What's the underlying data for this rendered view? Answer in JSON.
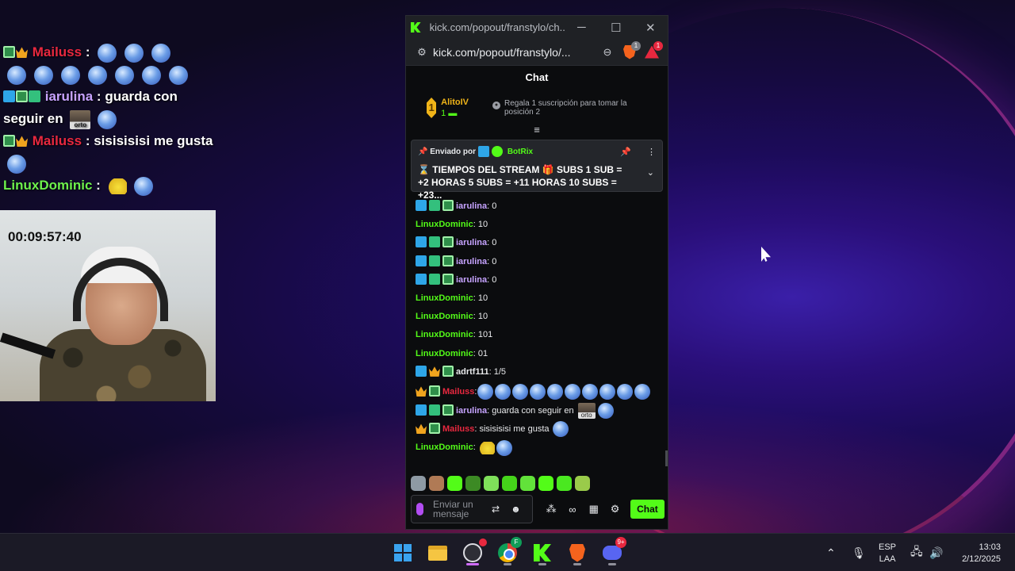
{
  "overlay": {
    "lines": [
      {
        "name": "Mailuss",
        "sep": " :",
        "text": ""
      },
      {
        "name": "iarulina",
        "sep": " :",
        "text": " guarda con seguir en"
      },
      {
        "name": "Mailuss",
        "sep": " :",
        "text": " sisisisisi me gusta"
      },
      {
        "name": "LinuxDominic",
        "sep": " :",
        "text": ""
      }
    ],
    "timer": "00:09:57:40",
    "orto_label": "orto"
  },
  "window": {
    "title": "kick.com/popout/franstylo/ch...",
    "minimize": "─",
    "maximize": "☐",
    "close": "✕",
    "url": "kick.com/popout/franstylo/...",
    "brave_badge": "1",
    "rewards_badge": "1"
  },
  "chat": {
    "header": "Chat",
    "leaderboard": {
      "rank": "1",
      "name": "AlitoIV",
      "count": "1",
      "info": "Regala 1 suscripción para tomar la posición 2"
    },
    "pinned": {
      "sent_by": "Enviado por",
      "bot": "BotRix",
      "message": "⌛ TIEMPOS DEL STREAM 🎁 SUBS 1 SUB = +2 HORAS 5 SUBS = +11 HORAS 10 SUBS = +23..."
    },
    "messages": [
      {
        "user": "iarulina",
        "text": ": 0"
      },
      {
        "user": "LinuxDominic",
        "text": ": 10"
      },
      {
        "user": "iarulina",
        "text": ": 0"
      },
      {
        "user": "iarulina",
        "text": ": 0"
      },
      {
        "user": "iarulina",
        "text": ": 0"
      },
      {
        "user": "LinuxDominic",
        "text": ": 10"
      },
      {
        "user": "LinuxDominic",
        "text": ": 10"
      },
      {
        "user": "LinuxDominic",
        "text": ": 101"
      },
      {
        "user": "LinuxDominic",
        "text": ": 01"
      },
      {
        "user": "adrtf111",
        "text": ": 1/5"
      },
      {
        "user": "Mailuss",
        "text": ":"
      },
      {
        "user": "iarulina",
        "text": ": guarda con seguir en"
      },
      {
        "user": "Mailuss",
        "text": ": sisisisisi me gusta"
      },
      {
        "user": "LinuxDominic",
        "text": ":"
      }
    ],
    "input_placeholder": "Enviar un mensaje",
    "send_label": "Chat"
  },
  "taskbar": {
    "obs_badge": "",
    "chrome_badge": "F",
    "discord_badge": "9+",
    "lang_top": "ESP",
    "lang_bottom": "LAA",
    "time": "13:03",
    "date": "2/12/2025"
  },
  "colors": {
    "kick_green": "#53fc18",
    "name_red": "#e8283f",
    "name_purple": "#c6a3ff"
  }
}
